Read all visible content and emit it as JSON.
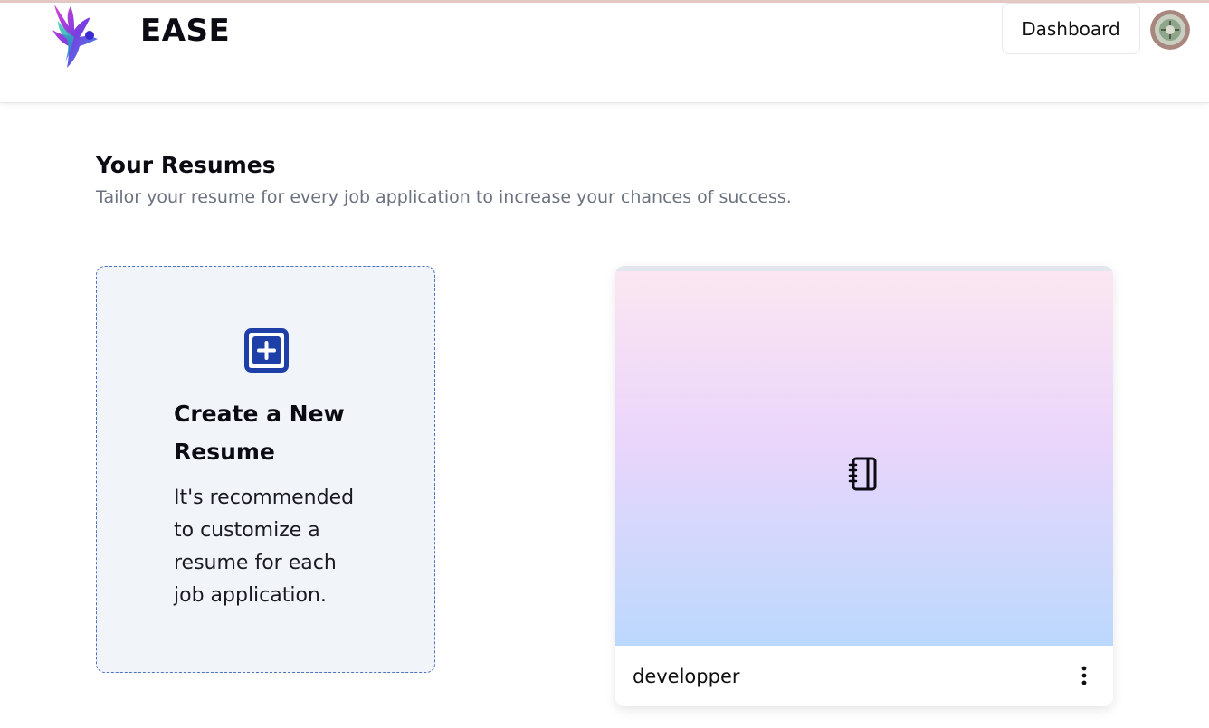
{
  "app": {
    "brand": "EASE"
  },
  "header": {
    "dashboard_label": "Dashboard"
  },
  "page": {
    "title": "Your Resumes",
    "subtitle": "Tailor your resume for every job application to increase your chances of success."
  },
  "create_card": {
    "title": "Create a New Resume",
    "description": "It's recommended to customize a resume for each job application.",
    "icon": "plus-square-icon"
  },
  "resumes": [
    {
      "name": "developper",
      "icon": "notebook-icon"
    }
  ],
  "colors": {
    "accent": "#1f3fa8",
    "dashed_border": "#4c72c4",
    "card_bg": "#f1f4f8",
    "subtitle": "#6b7280",
    "gradient_top": "#fbe6f1",
    "gradient_mid": "#ead6fb",
    "gradient_bottom": "#bcd8fd"
  }
}
